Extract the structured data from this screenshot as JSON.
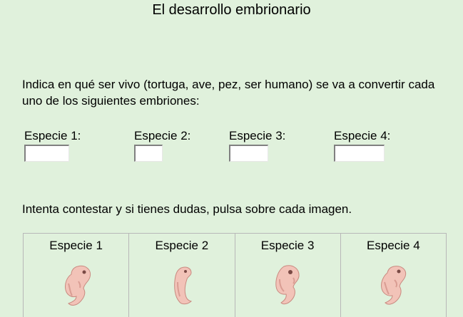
{
  "page": {
    "title": "El desarrollo embrionario",
    "instructions": "Indica en qué ser vivo (tortuga, ave, pez, ser humano) se va a convertir cada uno de los siguientes embriones:",
    "hint": "Intenta contestar y si tienes dudas, pulsa sobre cada imagen."
  },
  "answers": [
    {
      "label": "Especie 1:",
      "value": ""
    },
    {
      "label": "Especie 2:",
      "value": ""
    },
    {
      "label": "Especie 3:",
      "value": ""
    },
    {
      "label": "Especie 4:",
      "value": ""
    }
  ],
  "panels": [
    {
      "title": "Especie 1",
      "icon": "embryo-image"
    },
    {
      "title": "Especie 2",
      "icon": "embryo-image"
    },
    {
      "title": "Especie 3",
      "icon": "embryo-image"
    },
    {
      "title": "Especie 4",
      "icon": "embryo-image"
    }
  ],
  "colors": {
    "background": "#e0f1dc",
    "embryo_fill": "#f2c3b8",
    "embryo_stroke": "#c98a80"
  }
}
